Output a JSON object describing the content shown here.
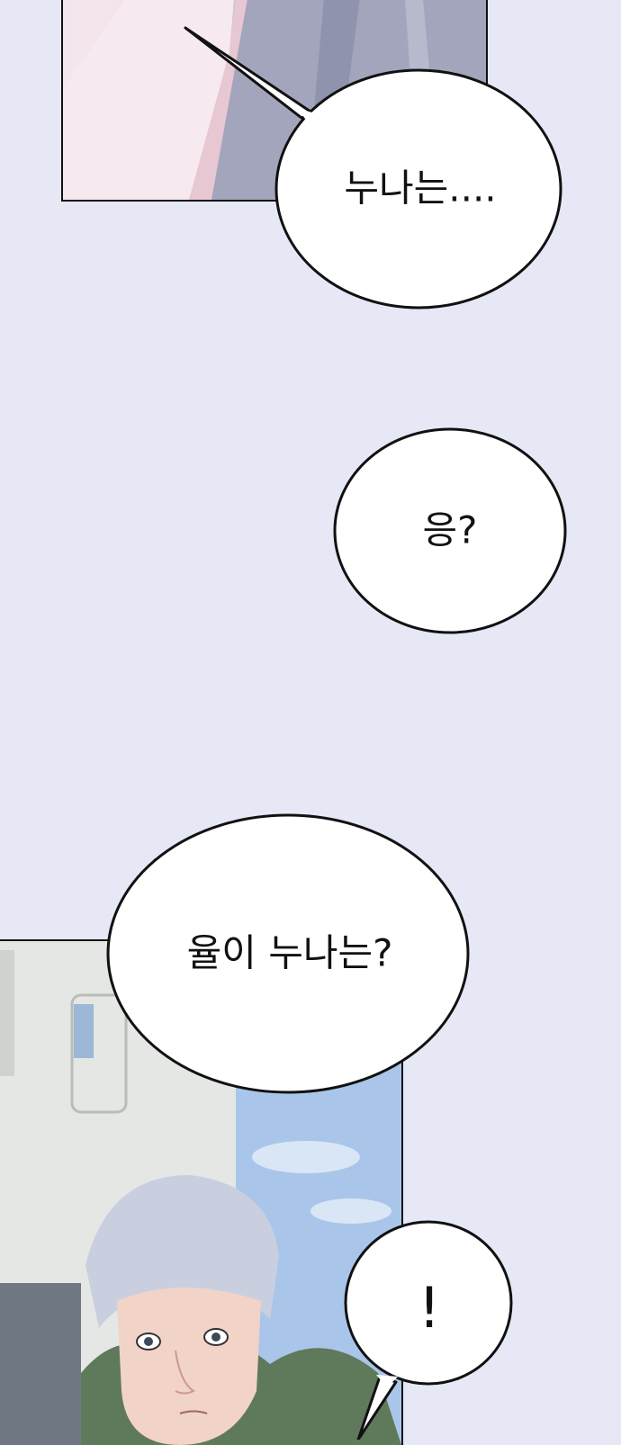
{
  "bubbles": {
    "first": "누나는....",
    "second": "응?",
    "third": "율이 누나는?",
    "fourth": "!"
  },
  "colors": {
    "background": "#e6e8f6",
    "bubble_fill": "#ffffff",
    "bubble_outline": "#111111"
  }
}
